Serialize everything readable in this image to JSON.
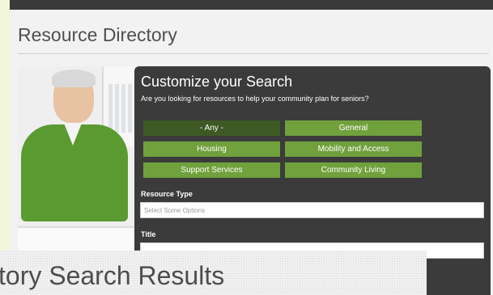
{
  "page": {
    "title": "Resource Directory"
  },
  "search_panel": {
    "title": "Customize your Search",
    "subtitle": "Are you looking for resources to help your community plan for seniors?",
    "filters": [
      {
        "label": "- Any -",
        "selected": true
      },
      {
        "label": "General",
        "selected": false
      },
      {
        "label": "Housing",
        "selected": false
      },
      {
        "label": "Mobility and Access",
        "selected": false
      },
      {
        "label": "Support Services",
        "selected": false
      },
      {
        "label": "Community Living",
        "selected": false
      }
    ],
    "resource_type": {
      "label": "Resource Type",
      "placeholder": "Select Some Options"
    },
    "title_field": {
      "label": "Title",
      "value": ""
    }
  },
  "results": {
    "heading": "tory Search Results"
  },
  "colors": {
    "panel": "#3b3b3b",
    "filter_green": "#70a13c",
    "filter_selected": "#3e5a24",
    "page_bg": "#f2f2f2"
  }
}
